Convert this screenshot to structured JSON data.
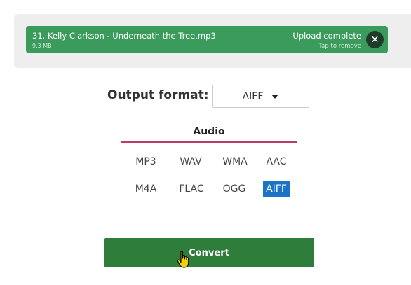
{
  "upload": {
    "file_name": "31. Kelly Clarkson - Underneath the Tree.mp3",
    "file_size": "9.3 MB",
    "status": "Upload complete",
    "hint": "Tap to remove",
    "remove_icon": "close-icon",
    "colors": {
      "bar": "#3a9b5c",
      "panel": "#eeeeee"
    }
  },
  "output": {
    "label": "Output format:",
    "selected_value": "AIFF"
  },
  "category": {
    "label": "Audio",
    "accent": "#c0396b"
  },
  "formats": [
    "MP3",
    "WAV",
    "WMA",
    "AAC",
    "M4A",
    "FLAC",
    "OGG",
    "AIFF"
  ],
  "selected_format": "AIFF",
  "convert": {
    "label": "Convert",
    "color": "#2f7d3a"
  },
  "icons": {
    "cursor": "hand-pointer-icon",
    "dropdown": "caret-down-icon"
  }
}
